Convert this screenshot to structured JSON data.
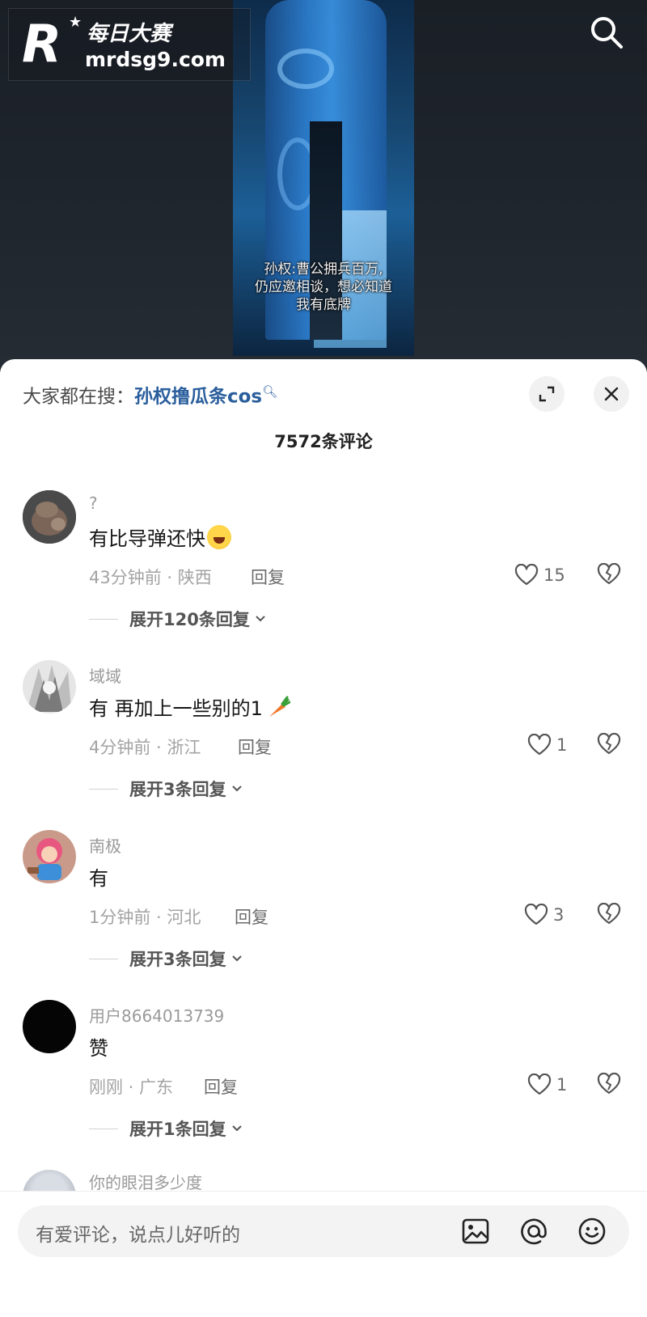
{
  "watermark": {
    "logo_letter": "R",
    "brand_cn": "每日大赛",
    "url": "mrdsg9.com"
  },
  "video": {
    "subtitle_lines": [
      "孙权:曹公拥兵百万,",
      "仍应邀相谈，想必知道",
      "我有底牌"
    ]
  },
  "icons": {
    "top_search": "search-icon",
    "expand": "expand-icon",
    "close": "close-icon",
    "like": "heart-icon",
    "dislike": "broken-heart-icon",
    "image": "image-icon",
    "mention": "at-icon",
    "emoji": "emoji-icon"
  },
  "comments_panel": {
    "search_prefix": "大家都在搜：",
    "search_term": "孙权撸瓜条cos",
    "comment_count": "7572条评论"
  },
  "comments": [
    {
      "user": "?",
      "text": "有比导弹还快",
      "emoji": "sweat-laugh-emoji",
      "time_location": "43分钟前 · 陕西",
      "reply_label": "回复",
      "likes": "15",
      "expand_label": "展开120条回复"
    },
    {
      "user": "域域",
      "text": "有 再加上一些别的1",
      "emoji": "carrot-emoji",
      "time_location": "4分钟前 · 浙江",
      "reply_label": "回复",
      "likes": "1",
      "expand_label": "展开3条回复"
    },
    {
      "user": "南极",
      "text": "有",
      "time_location": "1分钟前 · 河北",
      "reply_label": "回复",
      "likes": "3",
      "expand_label": "展开3条回复"
    },
    {
      "user": "用户8664013739",
      "text": "赞",
      "time_location": "刚刚 · 广东",
      "reply_label": "回复",
      "likes": "1",
      "expand_label": "展开1条回复"
    },
    {
      "user": "你的眼泪多少度"
    }
  ],
  "input": {
    "placeholder": "有爱评论，说点儿好听的"
  },
  "colors": {
    "link_blue": "#2a5e9c",
    "sheet_bg": "#ffffff",
    "video_bg": "#1e242c"
  }
}
